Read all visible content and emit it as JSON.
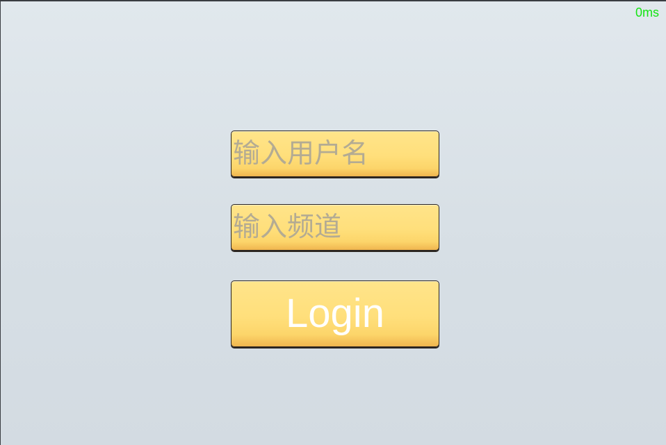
{
  "status": {
    "latency": "0ms"
  },
  "login_form": {
    "username_placeholder": "输入用户名",
    "channel_placeholder": "输入频道",
    "login_label": "Login"
  },
  "colors": {
    "button_fill": "#ffdf7b",
    "placeholder_text": "#b3ab93",
    "latency_text": "#13e413",
    "background": "#dbe3e8"
  }
}
